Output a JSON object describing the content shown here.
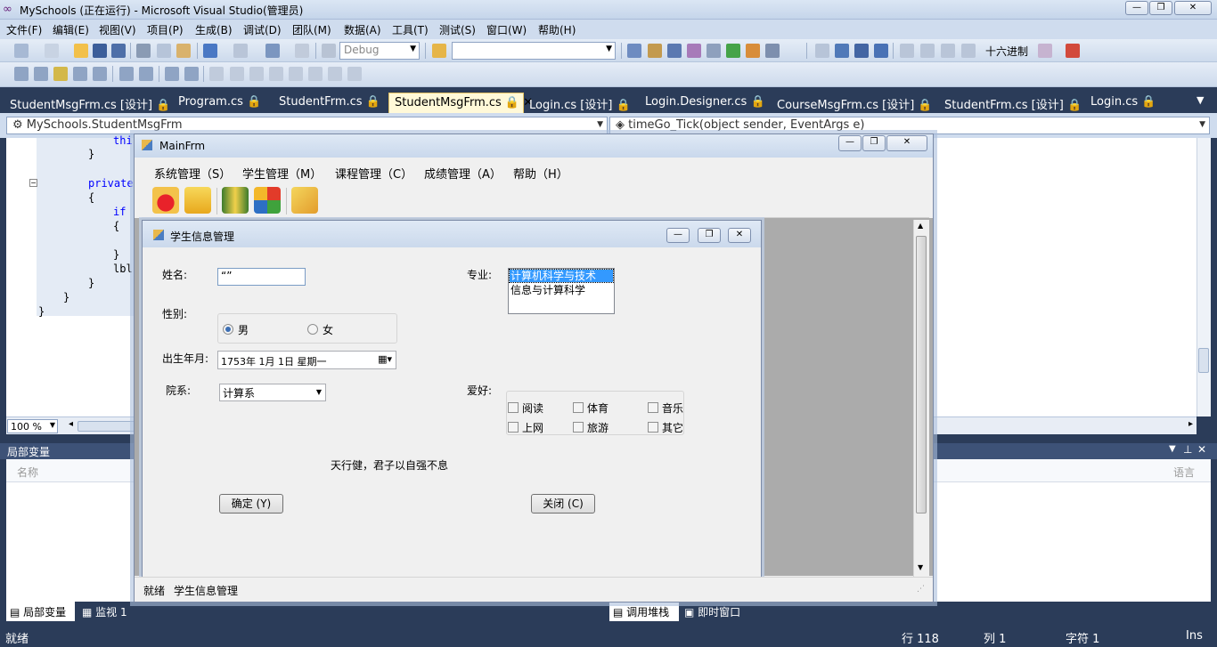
{
  "vs": {
    "title": "MySchools (正在运行) - Microsoft Visual Studio(管理员)",
    "menu": [
      "文件(F)",
      "编辑(E)",
      "视图(V)",
      "项目(P)",
      "生成(B)",
      "调试(D)",
      "团队(M)",
      "数据(A)",
      "工具(T)",
      "测试(S)",
      "窗口(W)",
      "帮助(H)"
    ],
    "toolbar": {
      "config": "Debug",
      "hex_label": "十六进制"
    },
    "tabs": [
      "StudentMsgFrm.cs [设计]",
      "Program.cs",
      "StudentFrm.cs",
      "StudentMsgFrm.cs",
      "Login.cs [设计]",
      "Login.Designer.cs",
      "CourseMsgFrm.cs [设计]",
      "StudentFrm.cs [设计]",
      "Login.cs"
    ],
    "nav": {
      "class": "MySchools.StudentMsgFrm",
      "member": "timeGo_Tick(object sender, EventArgs e)"
    },
    "code": {
      "l1": "thi",
      "l2": "}",
      "l3": "private",
      "l4": "{",
      "l5": "if",
      "l6": "{",
      "l7": "}",
      "l8": "lbl",
      "l9": "}",
      "l10": "}",
      "l11": "}"
    },
    "zoom": "100 %",
    "locals": {
      "title": "局部变量",
      "col_name": "名称",
      "col_lang": "语言"
    },
    "bottom_tabs": [
      "局部变量",
      "监视 1",
      "调用堆栈",
      "即时窗口"
    ],
    "status": {
      "ready": "就绪",
      "line": "行 118",
      "col": "列 1",
      "char": "字符 1",
      "mode": "Ins"
    }
  },
  "mainfrm": {
    "title": "MainFrm",
    "menu": [
      "系统管理（S）",
      "学生管理（M）",
      "课程管理（C）",
      "成绩管理（A）",
      "帮助（H）"
    ],
    "status": {
      "ready": "就绪",
      "form": "学生信息管理"
    }
  },
  "student": {
    "title": "学生信息管理",
    "name_label": "姓名:",
    "name_value": "“”",
    "gender_label": "性别:",
    "gender_male": "男",
    "gender_female": "女",
    "birth_label": "出生年月:",
    "birth_value": "1753年  1月  1日  星期一",
    "dept_label": "院系:",
    "dept_value": "计算系",
    "major_label": "专业:",
    "majors": [
      "计算机科学与技术",
      "信息与计算科学"
    ],
    "hobby_label": "爱好:",
    "hobbies": [
      "阅读",
      "体育",
      "音乐",
      "上网",
      "旅游",
      "其它"
    ],
    "motto": "天行健，君子以自强不息",
    "ok_button": "确定 (Y)",
    "close_button": "关闭 (C)"
  }
}
